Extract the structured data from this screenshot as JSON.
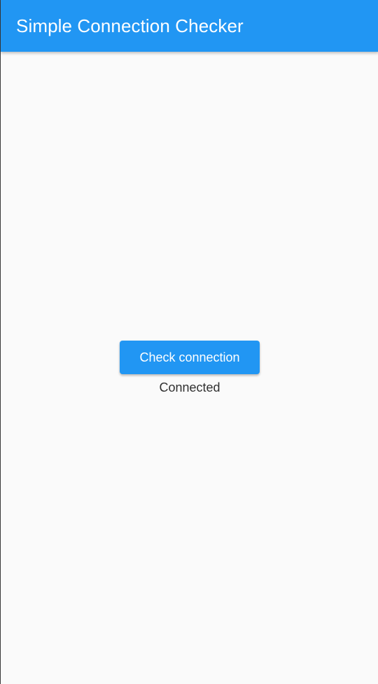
{
  "app_bar": {
    "title": "Simple Connection Checker"
  },
  "main": {
    "check_button_label": "Check connection",
    "status_text": "Connected"
  },
  "colors": {
    "primary": "#2196f3",
    "background": "#fafafa",
    "text": "#303030"
  }
}
